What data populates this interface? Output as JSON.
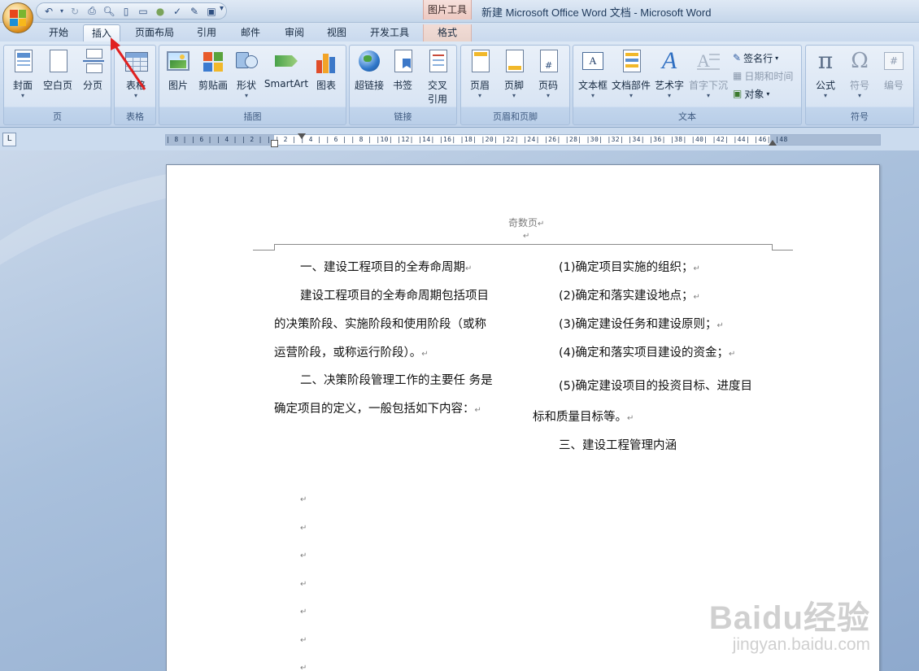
{
  "window": {
    "title": "新建 Microsoft Office Word 文档 - Microsoft Word",
    "context_tool_group": "图片工具"
  },
  "tabs": [
    {
      "label": "开始",
      "active": false
    },
    {
      "label": "插入",
      "active": true
    },
    {
      "label": "页面布局",
      "active": false
    },
    {
      "label": "引用",
      "active": false
    },
    {
      "label": "邮件",
      "active": false
    },
    {
      "label": "审阅",
      "active": false
    },
    {
      "label": "视图",
      "active": false
    },
    {
      "label": "开发工具",
      "active": false
    },
    {
      "label": "格式",
      "active": false
    }
  ],
  "ribbon": {
    "groups": {
      "page": "页",
      "table": "表格",
      "illustrations": "插图",
      "links": "链接",
      "header_footer": "页眉和页脚",
      "text": "文本",
      "symbols": "符号"
    },
    "buttons": {
      "cover": "封面",
      "blank": "空白页",
      "page_break": "分页",
      "table": "表格",
      "picture": "图片",
      "clipart": "剪贴画",
      "shapes": "形状",
      "smartart": "SmartArt",
      "chart": "图表",
      "hyperlink": "超链接",
      "bookmark": "书签",
      "crossref_1": "交叉",
      "crossref_2": "引用",
      "header": "页眉",
      "footer": "页脚",
      "page_number": "页码",
      "textbox": "文本框",
      "quickparts": "文档部件",
      "wordart": "艺术字",
      "dropcap": "首字下沉",
      "signature": "签名行",
      "datetime": "日期和时间",
      "object": "对象",
      "equation": "公式",
      "symbol": "符号",
      "numbering": "编号"
    }
  },
  "ruler": {
    "ticks": "| 8 |  | 6 |  | 4 |  | 2 |  |   | 2 |  | 4 |  | 6 |  | 8 |  |10|  |12|  |14|  |16|  |18|  |20|  |22|  |24|  |26|  |28|  |30|  |32|  |34|  |36|  |38|  |40|  |42|  |44|  |46|  |48"
  },
  "document": {
    "header_text": "奇数页",
    "left_column": [
      "一、建设工程项目的全寿命周期",
      "建设工程项目的全寿命周期包括项目",
      "的决策阶段、实施阶段和使用阶段（或称",
      "运营阶段，或称运行阶段）。",
      "二、决策阶段管理工作的主要任  务是",
      "确定项目的定义，一般包括如下内容："
    ],
    "right_column": [
      "(1)确定项目实施的组织；",
      "(2)确定和落实建设地点；",
      "(3)确定建设任务和建设原则；",
      "(4)确定和落实项目建设的资金；",
      "(5)确定建设项目的投资目标、进度目",
      "标和质量目标等。",
      "三、建设工程管理内涵"
    ],
    "paragraph_mark": "↵"
  },
  "watermark": {
    "main": "Baidu经验",
    "sub": "jingyan.baidu.com"
  }
}
